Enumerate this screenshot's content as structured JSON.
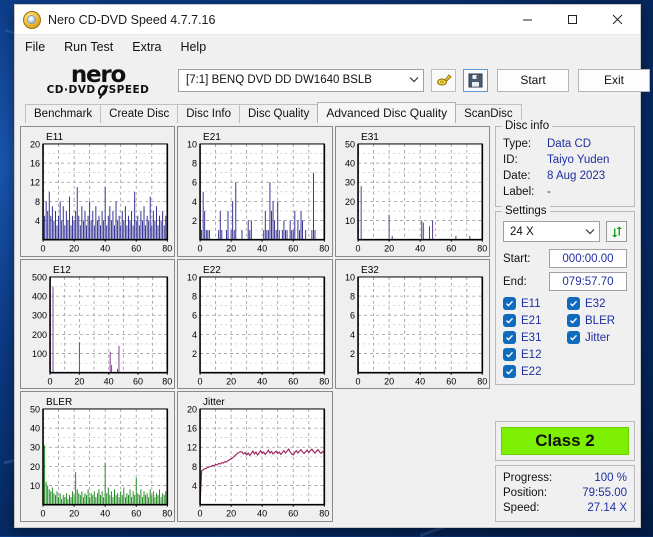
{
  "window": {
    "title": "Nero CD-DVD Speed 4.7.7.16",
    "icon": "nero-disc-icon",
    "minimize": "minimize-icon",
    "maximize": "maximize-icon",
    "close": "close-icon"
  },
  "menu": {
    "items": [
      {
        "label": "File"
      },
      {
        "label": "Run Test"
      },
      {
        "label": "Extra"
      },
      {
        "label": "Help"
      }
    ]
  },
  "toolbar": {
    "logo_main": "nero",
    "logo_sub_left": "CD·DVD",
    "logo_sub_right": "SPEED",
    "drive": "[7:1]   BENQ DVD DD DW1640 BSLB",
    "drive_caret": "chevron-down-icon",
    "eject_icon": "disc-tool-icon",
    "save_icon": "floppy-save-icon",
    "start_label": "Start",
    "exit_label": "Exit"
  },
  "tabs": [
    {
      "label": "Benchmark",
      "active": false
    },
    {
      "label": "Create Disc",
      "active": false
    },
    {
      "label": "Disc Info",
      "active": false
    },
    {
      "label": "Disc Quality",
      "active": false
    },
    {
      "label": "Advanced Disc Quality",
      "active": true
    },
    {
      "label": "ScanDisc",
      "active": false
    }
  ],
  "disc_info": {
    "legend": "Disc info",
    "rows": [
      {
        "key": "Type:",
        "value": "Data CD"
      },
      {
        "key": "ID:",
        "value": "Taiyo Yuden"
      },
      {
        "key": "Date:",
        "value": "8 Aug 2023"
      },
      {
        "key": "Label:",
        "value": "-"
      }
    ]
  },
  "settings": {
    "legend": "Settings",
    "speed": "24 X",
    "speed_caret": "chevron-down-icon",
    "refresh_icon": "refresh-arrows-icon",
    "start_label": "Start:",
    "start_value": "000:00.00",
    "end_label": "End:",
    "end_value": "079:57.70",
    "checkboxes": [
      {
        "label": "E11",
        "checked": true
      },
      {
        "label": "E32",
        "checked": true
      },
      {
        "label": "E21",
        "checked": true
      },
      {
        "label": "BLER",
        "checked": true
      },
      {
        "label": "E31",
        "checked": true
      },
      {
        "label": "Jitter",
        "checked": true
      },
      {
        "label": "E12",
        "checked": true
      },
      {
        "label": "",
        "checked": false
      },
      {
        "label": "E22",
        "checked": true
      },
      {
        "label": "",
        "checked": false
      }
    ]
  },
  "quality": {
    "class_label": "Class 2",
    "class_color": "#7cf000"
  },
  "status": {
    "rows": [
      {
        "key": "Progress:",
        "value": "100 %"
      },
      {
        "key": "Position:",
        "value": "79:55.00"
      },
      {
        "key": "Speed:",
        "value": "27.14 X"
      }
    ]
  },
  "chart_data": [
    {
      "type": "bar",
      "title": "E11",
      "xlabel": "",
      "ylabel": "",
      "xlim": [
        0,
        80
      ],
      "ylim": [
        0,
        20
      ],
      "xticks": [
        0,
        20,
        40,
        60,
        80
      ],
      "yticks": [
        4,
        8,
        12,
        16,
        20
      ],
      "grid": true,
      "color": "#25218a",
      "x": [
        0,
        1,
        2,
        3,
        4,
        5,
        6,
        7,
        8,
        9,
        10,
        11,
        12,
        13,
        14,
        15,
        16,
        17,
        18,
        19,
        20,
        21,
        22,
        23,
        24,
        25,
        26,
        27,
        28,
        29,
        30,
        31,
        32,
        33,
        34,
        35,
        36,
        37,
        38,
        39,
        40,
        41,
        42,
        43,
        44,
        45,
        46,
        47,
        48,
        49,
        50,
        51,
        52,
        53,
        54,
        55,
        56,
        57,
        58,
        59,
        60,
        61,
        62,
        63,
        64,
        65,
        66,
        67,
        68,
        69,
        70,
        71,
        72,
        73,
        74,
        75,
        76,
        77,
        78,
        79,
        80
      ],
      "values": [
        9,
        5,
        8,
        6,
        10,
        5,
        7,
        4,
        6,
        3,
        5,
        8,
        4,
        7,
        3,
        6,
        4,
        9,
        3,
        5,
        4,
        6,
        11,
        5,
        3,
        7,
        4,
        6,
        3,
        5,
        8,
        4,
        6,
        3,
        7,
        4,
        5,
        3,
        6,
        4,
        11,
        3,
        5,
        7,
        4,
        6,
        3,
        8,
        4,
        5,
        3,
        6,
        4,
        7,
        3,
        5,
        4,
        6,
        3,
        10,
        4,
        5,
        3,
        6,
        4,
        7,
        3,
        5,
        4,
        9,
        3,
        6,
        4,
        7,
        3,
        5,
        4,
        6,
        3,
        5,
        4
      ]
    },
    {
      "type": "bar",
      "title": "E21",
      "xlabel": "",
      "ylabel": "",
      "xlim": [
        0,
        80
      ],
      "ylim": [
        0,
        10
      ],
      "xticks": [
        0,
        20,
        40,
        60,
        80
      ],
      "yticks": [
        2,
        4,
        6,
        8,
        10
      ],
      "grid": true,
      "color": "#25218a",
      "x": [
        1,
        2,
        3,
        4,
        5,
        6,
        12,
        13,
        14,
        17,
        18,
        20,
        21,
        22,
        23,
        27,
        31,
        32,
        33,
        41,
        42,
        43,
        44,
        45,
        46,
        47,
        48,
        49,
        50,
        51,
        53,
        54,
        55,
        56,
        58,
        59,
        60,
        61,
        63,
        64,
        65,
        66,
        68,
        72,
        73,
        74
      ],
      "values": [
        1,
        5,
        3,
        1,
        1,
        1,
        1,
        3,
        1,
        1,
        3,
        1,
        4,
        1,
        6,
        1,
        2,
        1,
        2,
        1,
        3,
        1,
        1,
        6,
        3,
        4,
        2,
        1,
        4,
        1,
        1,
        2,
        1,
        1,
        2,
        1,
        1,
        3,
        2,
        1,
        3,
        2,
        1,
        1,
        7,
        1
      ]
    },
    {
      "type": "bar",
      "title": "E31",
      "xlabel": "",
      "ylabel": "",
      "xlim": [
        0,
        80
      ],
      "ylim": [
        0,
        50
      ],
      "xticks": [
        0,
        20,
        40,
        60,
        80
      ],
      "yticks": [
        10,
        20,
        30,
        40,
        50
      ],
      "grid": true,
      "color": "#4b2a7a",
      "x": [
        2,
        20,
        22,
        41,
        42,
        46,
        48,
        63,
        72
      ],
      "values": [
        28,
        13,
        2,
        10,
        9,
        7,
        10,
        2,
        2
      ]
    },
    {
      "type": "bar",
      "title": "E12",
      "xlabel": "",
      "ylabel": "",
      "xlim": [
        0,
        80
      ],
      "ylim": [
        0,
        500
      ],
      "xticks": [
        0,
        20,
        40,
        60,
        80
      ],
      "yticks": [
        100,
        200,
        300,
        400,
        500
      ],
      "grid": true,
      "color": "#7a2a8a",
      "x": [
        2,
        20,
        41,
        42,
        46,
        47
      ],
      "values": [
        450,
        160,
        110,
        40,
        20,
        140
      ]
    },
    {
      "type": "bar",
      "title": "E22",
      "xlabel": "",
      "ylabel": "",
      "xlim": [
        0,
        80
      ],
      "ylim": [
        0,
        10
      ],
      "xticks": [
        0,
        20,
        40,
        60,
        80
      ],
      "yticks": [
        2,
        4,
        6,
        8,
        10
      ],
      "grid": true,
      "color": "#25218a",
      "x": [],
      "values": []
    },
    {
      "type": "bar",
      "title": "E32",
      "xlabel": "",
      "ylabel": "",
      "xlim": [
        0,
        80
      ],
      "ylim": [
        0,
        10
      ],
      "xticks": [
        0,
        20,
        40,
        60,
        80
      ],
      "yticks": [
        2,
        4,
        6,
        8,
        10
      ],
      "grid": true,
      "color": "#25218a",
      "x": [],
      "values": []
    },
    {
      "type": "bar",
      "title": "BLER",
      "xlabel": "",
      "ylabel": "",
      "xlim": [
        0,
        80
      ],
      "ylim": [
        0,
        50
      ],
      "xticks": [
        0,
        20,
        40,
        60,
        80
      ],
      "yticks": [
        10,
        20,
        30,
        40,
        50
      ],
      "grid": true,
      "color": "#108010",
      "x": [
        0,
        1,
        2,
        3,
        4,
        5,
        6,
        7,
        8,
        9,
        10,
        11,
        12,
        13,
        14,
        15,
        16,
        17,
        18,
        19,
        20,
        21,
        22,
        23,
        24,
        25,
        26,
        27,
        28,
        29,
        30,
        31,
        32,
        33,
        34,
        35,
        36,
        37,
        38,
        39,
        40,
        41,
        42,
        43,
        44,
        45,
        46,
        47,
        48,
        49,
        50,
        51,
        52,
        53,
        54,
        55,
        56,
        57,
        58,
        59,
        60,
        61,
        62,
        63,
        64,
        65,
        66,
        67,
        68,
        69,
        70,
        71,
        72,
        73,
        74,
        75,
        76,
        77,
        78,
        79,
        80
      ],
      "values": [
        6,
        31,
        12,
        10,
        8,
        7,
        9,
        6,
        5,
        7,
        4,
        6,
        3,
        5,
        4,
        6,
        3,
        5,
        4,
        7,
        5,
        17,
        8,
        6,
        5,
        7,
        4,
        6,
        5,
        8,
        4,
        6,
        5,
        7,
        4,
        6,
        8,
        5,
        7,
        4,
        22,
        6,
        9,
        5,
        7,
        4,
        8,
        5,
        6,
        4,
        7,
        5,
        9,
        4,
        6,
        5,
        8,
        4,
        7,
        5,
        14,
        6,
        5,
        8,
        4,
        7,
        5,
        6,
        4,
        8,
        5,
        7,
        4,
        6,
        5,
        8,
        4,
        6,
        5,
        7,
        4
      ]
    },
    {
      "type": "line",
      "title": "Jitter",
      "xlabel": "",
      "ylabel": "",
      "xlim": [
        0,
        80
      ],
      "ylim": [
        0,
        20
      ],
      "xticks": [
        0,
        20,
        40,
        60,
        80
      ],
      "yticks": [
        4,
        8,
        12,
        16,
        20
      ],
      "grid": true,
      "color": "#9b1b5a",
      "x": [
        0,
        1,
        2,
        3,
        4,
        5,
        6,
        7,
        8,
        9,
        10,
        11,
        12,
        13,
        14,
        15,
        16,
        17,
        18,
        19,
        20,
        21,
        22,
        23,
        24,
        25,
        26,
        27,
        28,
        29,
        30,
        31,
        32,
        33,
        34,
        35,
        36,
        37,
        38,
        39,
        40,
        41,
        42,
        43,
        44,
        45,
        46,
        47,
        48,
        49,
        50,
        51,
        52,
        53,
        54,
        55,
        56,
        57,
        58,
        59,
        60,
        61,
        62,
        63,
        64,
        65,
        66,
        67,
        68,
        69,
        70,
        71,
        72,
        73,
        74,
        75,
        76,
        77,
        78,
        79,
        80
      ],
      "values": [
        0,
        7.1,
        7.3,
        7.5,
        7.6,
        7.8,
        7.9,
        8.0,
        8.2,
        8.1,
        8.4,
        8.3,
        8.6,
        8.5,
        8.8,
        8.7,
        9.0,
        8.9,
        9.2,
        9.4,
        9.6,
        9.8,
        10.1,
        10.4,
        10.7,
        10.9,
        11.1,
        11.0,
        10.6,
        10.9,
        10.4,
        10.8,
        10.3,
        10.7,
        11.2,
        10.6,
        11.0,
        10.4,
        10.8,
        11.3,
        10.7,
        11.0,
        10.5,
        10.9,
        11.4,
        10.8,
        11.1,
        10.6,
        10.9,
        11.2,
        10.7,
        11.0,
        10.5,
        10.9,
        11.3,
        10.8,
        11.2,
        11.6,
        11.0,
        10.6,
        10.4,
        10.9,
        11.3,
        10.8,
        11.2,
        11.5,
        11.0,
        10.7,
        11.1,
        11.4,
        10.9,
        11.3,
        11.6,
        11.1,
        10.8,
        11.2,
        11.5,
        11.0,
        10.7,
        11.1,
        10.9
      ]
    }
  ]
}
